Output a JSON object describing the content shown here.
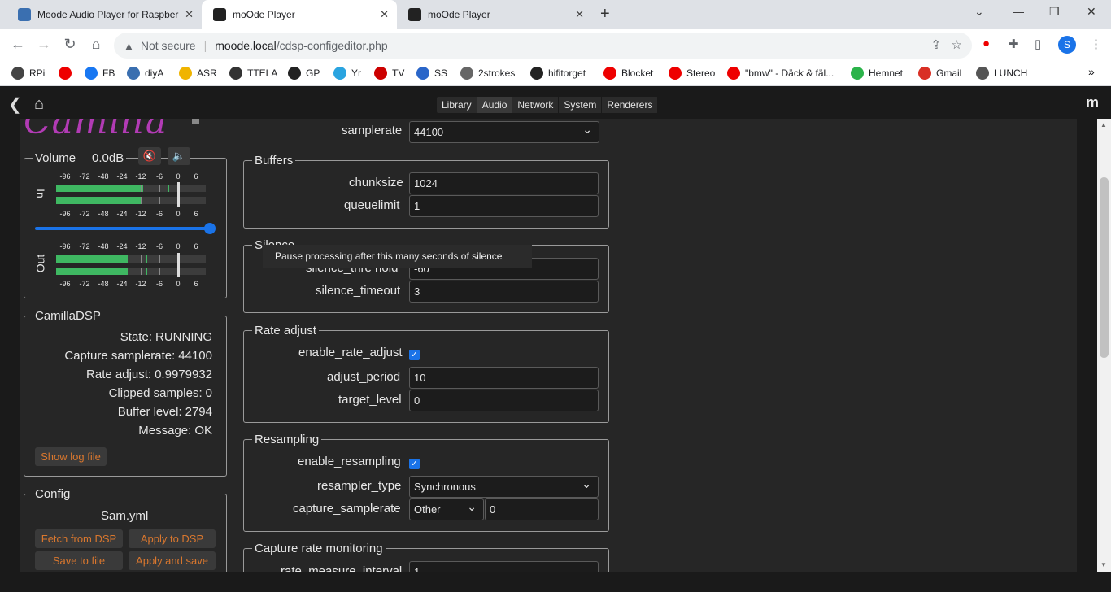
{
  "browser": {
    "tabs": [
      {
        "title": "Moode Audio Player for Raspber",
        "close": "✕"
      },
      {
        "title": "moOde Player",
        "close": "✕"
      },
      {
        "title": "moOde Player",
        "close": "✕"
      }
    ],
    "new_tab": "+",
    "win_controls": [
      "⌄",
      "—",
      "❐",
      "✕"
    ],
    "not_secure": "Not secure",
    "url_host": "moode.local",
    "url_path": "/cdsp-configeditor.php",
    "profile_letter": "S",
    "bookmarks": [
      {
        "label": "RPi",
        "color": "#444"
      },
      {
        "label": "",
        "color": "#e00"
      },
      {
        "label": "FB",
        "color": "#1877f2"
      },
      {
        "label": "diyA",
        "color": "#3a6fb0"
      },
      {
        "label": "ASR",
        "color": "#f0b400"
      },
      {
        "label": "TTELA",
        "color": "#333"
      },
      {
        "label": "GP",
        "color": "#222"
      },
      {
        "label": "Yr",
        "color": "#2aa4e0"
      },
      {
        "label": "TV",
        "color": "#c00"
      },
      {
        "label": "SS",
        "color": "#2a66c9"
      },
      {
        "label": "2strokes",
        "color": "#666"
      },
      {
        "label": "hifitorget",
        "color": "#222"
      },
      {
        "label": "Blocket",
        "color": "#e00"
      },
      {
        "label": "Stereo",
        "color": "#e00"
      },
      {
        "label": "\"bmw\" - Däck & fäl...",
        "color": "#e00"
      },
      {
        "label": "Hemnet",
        "color": "#2bb34a"
      },
      {
        "label": "Gmail",
        "color": "#d93025"
      },
      {
        "label": "LUNCH",
        "color": "#555"
      }
    ],
    "more_bookmarks": "»"
  },
  "app": {
    "menu": [
      "Library",
      "Audio",
      "Network",
      "System",
      "Renderers"
    ],
    "active_menu": "Audio",
    "brand": "m"
  },
  "left": {
    "logo_text": "Camilla",
    "volume": {
      "legend": "Volume",
      "value": "0.0dB",
      "mute_icon": "🔇",
      "speaker_icon": "🔈",
      "level_fraction": 1.0,
      "in_label": "In",
      "out_label": "Out",
      "scale": [
        "-96",
        "-72",
        "-48",
        "-24",
        "-12",
        "-6",
        "0",
        "6"
      ]
    },
    "camilladsp": {
      "legend": "CamillaDSP",
      "rows": [
        {
          "label": "State:",
          "value": "RUNNING"
        },
        {
          "label": "Capture samplerate:",
          "value": "44100"
        },
        {
          "label": "Rate adjust:",
          "value": "0.9979932"
        },
        {
          "label": "Clipped samples:",
          "value": "0"
        },
        {
          "label": "Buffer level:",
          "value": "2794"
        },
        {
          "label": "Message:",
          "value": "OK"
        }
      ],
      "show_log": "Show log file"
    },
    "config": {
      "legend": "Config",
      "file": "Sam.yml",
      "fetch": "Fetch from DSP",
      "apply": "Apply to DSP",
      "save": "Save to file",
      "apply_save": "Apply and save"
    }
  },
  "editor": {
    "samplerate_label": "samplerate",
    "samplerate_value": "44100",
    "buffers": {
      "legend": "Buffers",
      "chunksize_label": "chunksize",
      "chunksize": "1024",
      "queuelimit_label": "queuelimit",
      "queuelimit": "1"
    },
    "silence": {
      "legend": "Silence",
      "threshold_label": "silence_thre  hold",
      "threshold": "-60",
      "timeout_label": "silence_timeout",
      "timeout": "3"
    },
    "tooltip": "Pause processing after this many seconds of silence",
    "rate_adjust": {
      "legend": "Rate adjust",
      "enable_label": "enable_rate_adjust",
      "enabled": "✓",
      "period_label": "adjust_period",
      "period": "10",
      "target_label": "target_level",
      "target": "0"
    },
    "resampling": {
      "legend": "Resampling",
      "enable_label": "enable_resampling",
      "enabled": "✓",
      "type_label": "resampler_type",
      "type": "Synchronous",
      "capture_label": "capture_samplerate",
      "capture_select": "Other",
      "capture_value": "0"
    },
    "capture_rate": {
      "legend": "Capture rate monitoring",
      "interval_label": "rate_measure_interval",
      "interval": "1"
    }
  }
}
